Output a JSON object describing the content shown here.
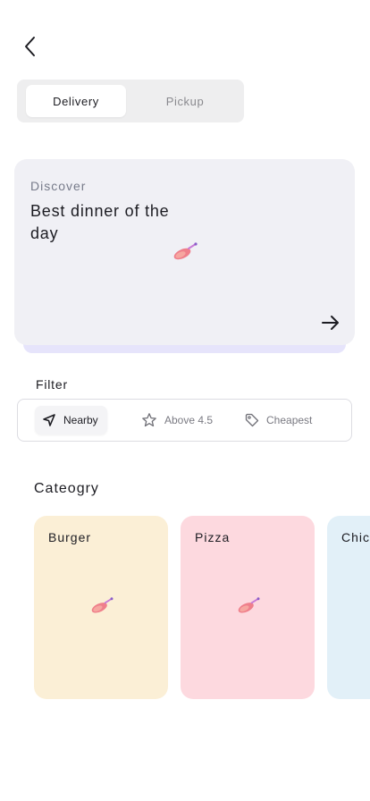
{
  "header": {
    "back_icon": "chevron-left-icon"
  },
  "mode_switch": {
    "tabs": [
      {
        "label": "Delivery",
        "active": true
      },
      {
        "label": "Pickup",
        "active": false
      }
    ]
  },
  "hero": {
    "kicker": "Discover",
    "title": "Best dinner of the day",
    "background_color": "#f0f0f5",
    "accent_color": "#e6e4fb",
    "image_icon": "food-illustration-icon",
    "arrow_icon": "arrow-right-icon"
  },
  "filter": {
    "heading": "Filter",
    "chips": [
      {
        "label": "Nearby",
        "icon": "navigation-arrow-icon",
        "active": true
      },
      {
        "label": "Above 4.5",
        "icon": "star-icon",
        "active": false
      },
      {
        "label": "Cheapest",
        "icon": "price-tag-icon",
        "active": false
      }
    ]
  },
  "category": {
    "heading": "Cateogry",
    "items": [
      {
        "label": "Burger",
        "color": "#fbefd6"
      },
      {
        "label": "Pizza",
        "color": "#fdd9df"
      },
      {
        "label": "Chic",
        "color": "#e2f0f8"
      }
    ]
  }
}
